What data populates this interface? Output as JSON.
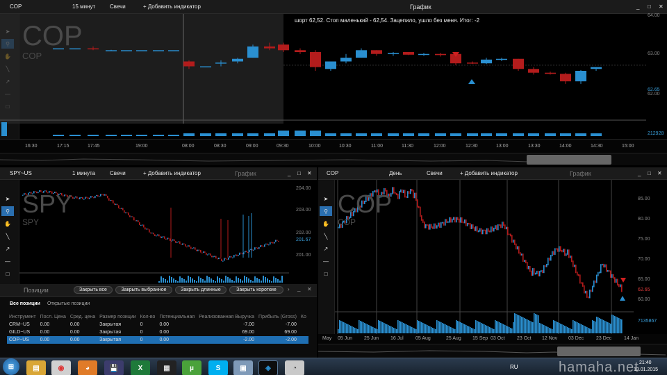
{
  "main": {
    "symbol": "COP",
    "timeframe": "15 минут",
    "chart_type": "Свечи",
    "add_indicator": "+ Добавить индикатор",
    "title": "График",
    "watermark_big": "COP",
    "watermark_small": "COP",
    "annotation": "шорт 62,52. Стоп маленький - 62,54. Зацепило, ушло без меня. Итог: -2",
    "y_ticks": [
      "64.00",
      "63.00",
      "62.65",
      "62.00",
      "212928"
    ],
    "x_ticks": [
      "16:30",
      "17:15",
      "17:45",
      "19:00",
      "08:00",
      "08:30",
      "09:00",
      "09:30",
      "10:00",
      "10:30",
      "11:00",
      "11:30",
      "12:00",
      "12:30",
      "13:00",
      "13:30",
      "14:00",
      "14:30",
      "15:00"
    ]
  },
  "spy": {
    "symbol": "SPY~US",
    "timeframe": "1 минута",
    "chart_type": "Свечи",
    "add_indicator": "+ Добавить индикатор",
    "title": "График",
    "watermark_big": "SPY",
    "watermark_small": "SPY",
    "y_ticks": [
      "204.00",
      "203.00",
      "202.00",
      "201.67",
      "201.00"
    ]
  },
  "cop_day": {
    "symbol": "COP",
    "timeframe": "День",
    "chart_type": "Свечи",
    "add_indicator": "+ Добавить индикатор",
    "title": "График",
    "watermark_big": "COP",
    "watermark_small": "COP",
    "y_ticks": [
      "85.00",
      "80.00",
      "75.00",
      "70.00",
      "65.00",
      "62.65",
      "60.00",
      "7135867"
    ],
    "x_ticks": [
      "May",
      "05 Jun",
      "25 Jun",
      "16 Jul",
      "05 Aug",
      "25 Aug",
      "15 Sep",
      "03 Oct",
      "23 Oct",
      "12 Nov",
      "03 Dec",
      "23 Dec",
      "14 Jan"
    ]
  },
  "positions": {
    "title": "Позиции",
    "buttons": [
      "Закрыть все",
      "Закрыть выбранное",
      "Закрыть длинные",
      "Закрыть короткие"
    ],
    "tabs": [
      "Все позиции",
      "Открытые позиции"
    ],
    "columns": [
      "Инструмент",
      "Посл. Цена",
      "Сред. цена",
      "Размер позиции",
      "Кол-во",
      "Потенциальная",
      "Реализованная Выручка",
      "Прибыль (Gross)",
      "Ко"
    ],
    "rows": [
      {
        "inst": "CRM~US",
        "last": "0.00",
        "avg": "0.00",
        "size": "Закрытая",
        "qty": "0",
        "pot": "0.00",
        "real": "-7.00",
        "gross": "-7.00"
      },
      {
        "inst": "GILD~US",
        "last": "0.00",
        "avg": "0.00",
        "size": "Закрытая",
        "qty": "0",
        "pot": "0.00",
        "real": "69.00",
        "gross": "69.00"
      },
      {
        "inst": "COP~US",
        "last": "0.00",
        "avg": "0.00",
        "size": "Закрытая",
        "qty": "0",
        "pot": "0.00",
        "real": "-2.00",
        "gross": "-2.00"
      }
    ]
  },
  "taskbar": {
    "lang": "RU",
    "time": "21:40",
    "date": "13.01.2015",
    "watermark": "hamaha.net"
  },
  "colors": {
    "up": "#2a8fd0",
    "down": "#b31c1c",
    "volume": "#2a8fd0"
  }
}
